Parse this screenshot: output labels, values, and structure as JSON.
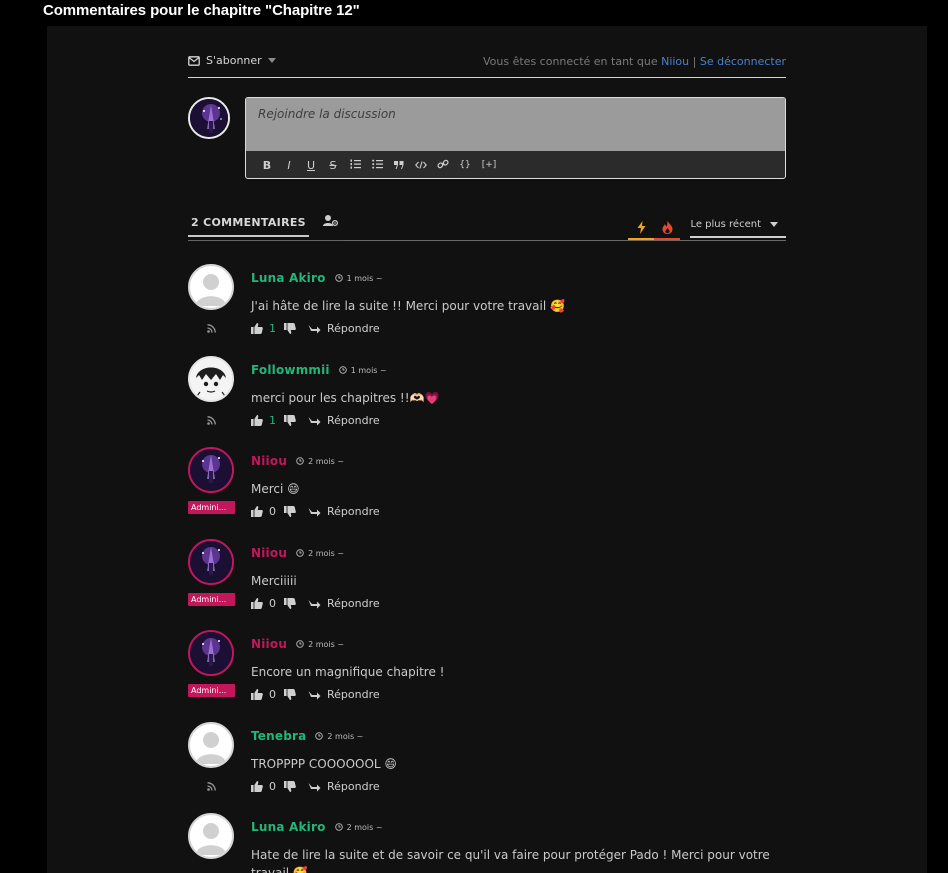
{
  "page": {
    "title": "Commentaires pour le chapitre \"Chapitre 12\""
  },
  "header": {
    "subscribe_label": "S'abonner",
    "login_prefix": "Vous êtes connecté en tant que",
    "user": "Niiou",
    "separator": "|",
    "logout": "Se déconnecter"
  },
  "editor": {
    "placeholder": "Rejoindre la discussion",
    "toolbar": [
      "B",
      "I",
      "U",
      "S",
      "ol",
      "ul",
      "quote",
      "code",
      "link",
      "{}",
      "[+]"
    ]
  },
  "tabs": {
    "count_label": "2 COMMENTAIRES",
    "sort_label": "Le plus récent"
  },
  "comments": [
    {
      "author": "Luna Akiro",
      "time": "1 mois",
      "text": "J'ai hâte de lire la suite !! Merci pour votre travail 🥰",
      "likes": "1",
      "reply": "Répondre",
      "role": ""
    },
    {
      "author": "Followmmii",
      "time": "1 mois",
      "text": "merci pour les chapitres !!🫶🏻💗",
      "likes": "1",
      "reply": "Répondre",
      "role": ""
    },
    {
      "author": "Niiou",
      "time": "2 mois",
      "text": "Merci 😄",
      "likes": "0",
      "reply": "Répondre",
      "role": "Admini..."
    },
    {
      "author": "Niiou",
      "time": "2 mois",
      "text": "Merciiiii",
      "likes": "0",
      "reply": "Répondre",
      "role": "Admini..."
    },
    {
      "author": "Niiou",
      "time": "2 mois",
      "text": "Encore un magnifique chapitre !",
      "likes": "0",
      "reply": "Répondre",
      "role": "Admini..."
    },
    {
      "author": "Tenebra",
      "time": "2 mois",
      "text": "TROPPPP COOOOOOL 😄",
      "likes": "0",
      "reply": "Répondre",
      "role": ""
    },
    {
      "author": "Luna Akiro",
      "time": "2 mois",
      "text": "Hate de lire la suite et de savoir ce qu'il va faire pour protéger Pado ! Merci pour votre travail 🥰",
      "likes": "",
      "reply": "",
      "role": ""
    }
  ],
  "colors": {
    "green": "#24b57a",
    "admin": "#c2185b",
    "link": "#4a7fd0"
  }
}
